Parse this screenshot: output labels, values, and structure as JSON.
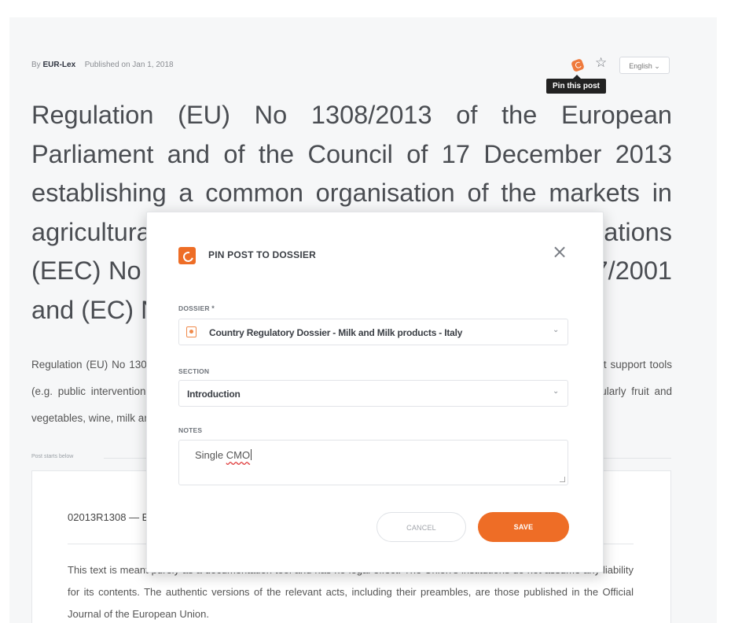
{
  "meta": {
    "by_label": "By",
    "author": "EUR-Lex",
    "published": "Published on Jan 1, 2018"
  },
  "toolbar": {
    "pin_icon": "pin-icon",
    "star_icon": "star-icon",
    "language": "English ⌄",
    "tooltip": "Pin this post"
  },
  "article": {
    "title": "Regulation (EU) No 1308/2013 of the European Parliament and of the Council of 17 December 2013 establishing a common organisation of the markets in agricultural products and repealing Council Regulations (EEC) No 922/72, (EEC) No 234/79, (EC) No 1037/2001 and (EC) No 1234/2007",
    "summary": "Regulation (EU) No 1308/2013 establishes the common organisation of agricultural markets, setting out rules on market support tools (e.g. public intervention and private storage aid), marketing standards and specific rules for specific sectors (particularly fruit and vegetables, wine, milk and sugar).",
    "post_starts": "Post starts below",
    "post_code": "02013R1308 — EN — 01.01.2018 — 005.001",
    "post_text": "This text is meant purely as a documentation tool and has no legal effect. The Union's institutions do not assume any liability for its contents. The authentic versions of the relevant acts, including their preambles, are those published in the Official Journal of the European Union."
  },
  "modal": {
    "title": "PIN POST TO DOSSIER",
    "close": "×",
    "dossier_label": "DOSSIER",
    "required_mark": "*",
    "dossier_value": "Country Regulatory Dossier - Milk and Milk products - Italy",
    "section_label": "SECTION",
    "section_value": "Introduction",
    "notes_label": "NOTES",
    "notes_value_a": "Single ",
    "notes_value_b": "CMO",
    "chevron": "⌄",
    "cancel": "CANCEL",
    "save": "SAVE"
  },
  "colors": {
    "accent": "#ee6d26",
    "tooltip_bg": "#222222"
  }
}
